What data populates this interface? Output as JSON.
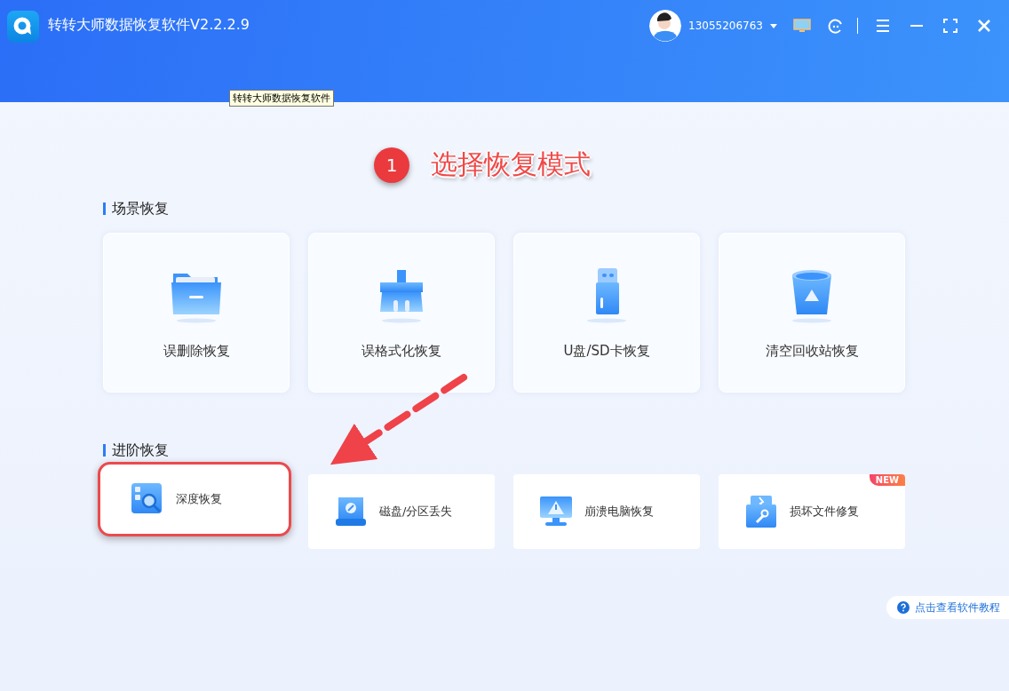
{
  "window": {
    "title": "转转大师数据恢复软件V2.2.2.9",
    "tooltip": "转转大师数据恢复软件"
  },
  "account": {
    "phone": "13055206763"
  },
  "annotation": {
    "step": "1",
    "text": "选择恢复模式"
  },
  "sections": [
    {
      "title": "场景恢复",
      "kind": "large",
      "cards": [
        {
          "label": "误删除恢复",
          "kind": "folder",
          "highlighted": false
        },
        {
          "label": "误格式化恢复",
          "kind": "broom",
          "highlighted": false
        },
        {
          "label": "U盘/SD卡恢复",
          "kind": "usb",
          "highlighted": false
        },
        {
          "label": "清空回收站恢复",
          "kind": "bin",
          "highlighted": false
        }
      ]
    },
    {
      "title": "进阶恢复",
      "kind": "compact",
      "cards": [
        {
          "label": "深度恢复",
          "kind": "deep",
          "highlighted": true
        },
        {
          "label": "磁盘/分区丢失",
          "kind": "disk",
          "highlighted": false
        },
        {
          "label": "崩溃电脑恢复",
          "kind": "monitor",
          "highlighted": false
        },
        {
          "label": "损坏文件修复",
          "kind": "repair",
          "highlighted": false,
          "badge": "NEW"
        }
      ]
    }
  ],
  "help": {
    "label": "点击查看软件教程"
  }
}
